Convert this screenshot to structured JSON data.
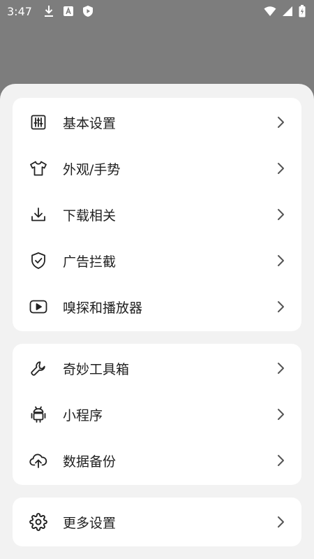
{
  "status_bar": {
    "time": "3:47",
    "icons_left": [
      "download-icon",
      "a-badge-icon",
      "shield-play-icon"
    ],
    "icons_right": [
      "wifi-icon",
      "signal-icon",
      "battery-icon"
    ]
  },
  "groups": [
    {
      "items": [
        {
          "label": "基本设置",
          "icon": "sliders-icon"
        },
        {
          "label": "外观/手势",
          "icon": "tshirt-icon"
        },
        {
          "label": "下载相关",
          "icon": "download-icon"
        },
        {
          "label": "广告拦截",
          "icon": "shield-check-icon"
        },
        {
          "label": "嗅探和播放器",
          "icon": "play-icon"
        }
      ]
    },
    {
      "items": [
        {
          "label": "奇妙工具箱",
          "icon": "wrench-icon"
        },
        {
          "label": "小程序",
          "icon": "android-icon"
        },
        {
          "label": "数据备份",
          "icon": "cloud-upload-icon"
        }
      ]
    },
    {
      "items": [
        {
          "label": "更多设置",
          "icon": "gear-icon"
        }
      ]
    }
  ],
  "colors": {
    "overlay": "#7d7d7d",
    "sheet_background": "#f2f2f2",
    "card_background": "#ffffff",
    "text": "#202020",
    "icon": "#222222",
    "chevron": "#555555"
  }
}
